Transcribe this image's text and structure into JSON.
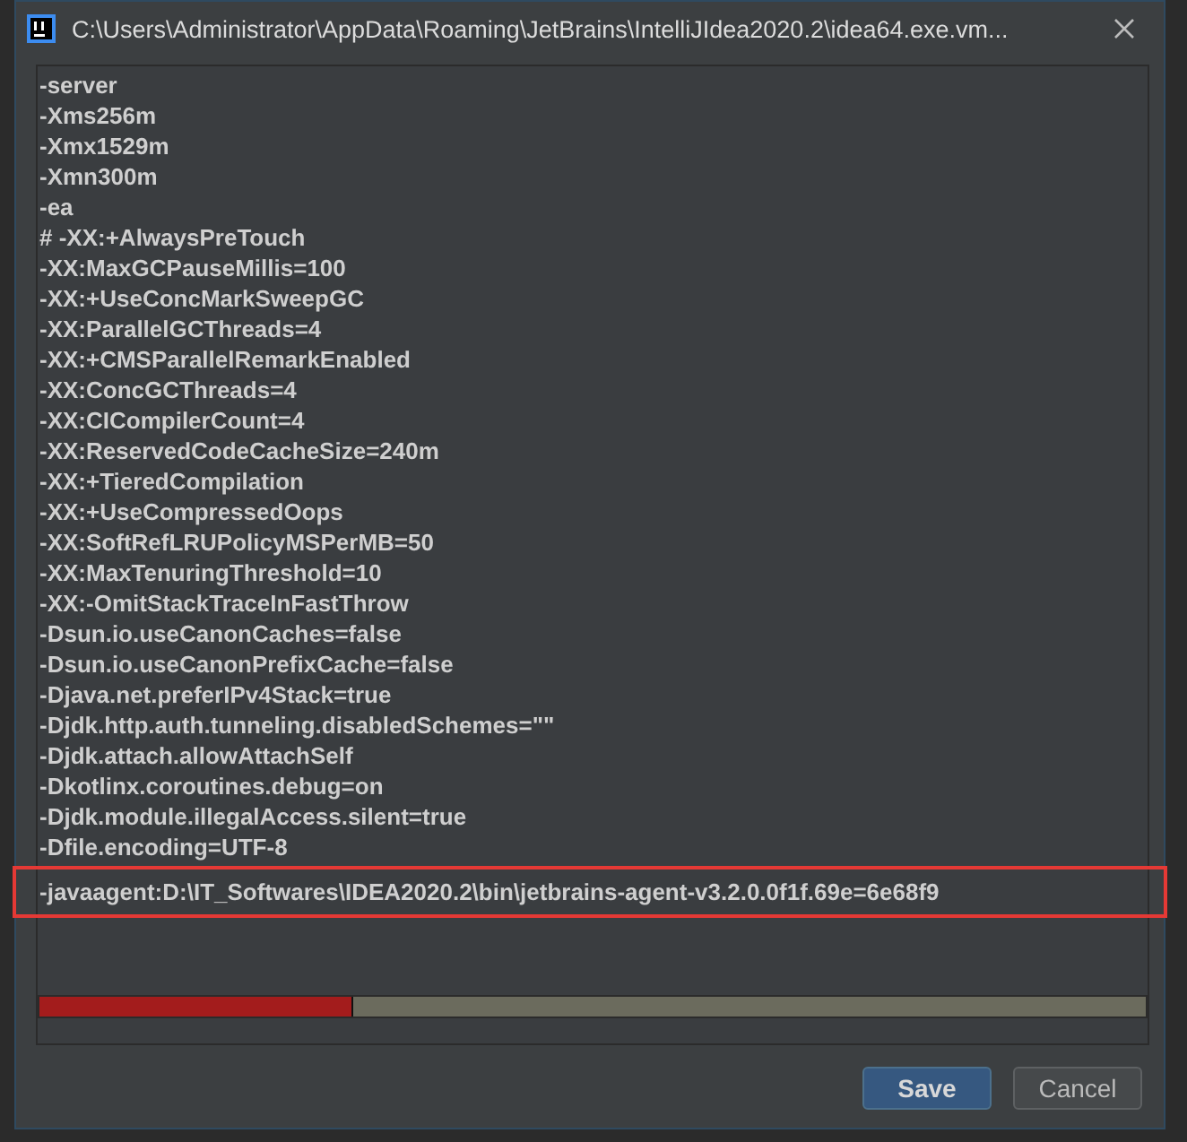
{
  "window": {
    "title": "C:\\Users\\Administrator\\AppData\\Roaming\\JetBrains\\IntelliJIdea2020.2\\idea64.exe.vm..."
  },
  "editor": {
    "lines": [
      {
        "text": "-server",
        "highlighted": false
      },
      {
        "text": "-Xms256m",
        "highlighted": false
      },
      {
        "text": "-Xmx1529m",
        "highlighted": false
      },
      {
        "text": "-Xmn300m",
        "highlighted": false
      },
      {
        "text": "-ea",
        "highlighted": false
      },
      {
        "text": "# -XX:+AlwaysPreTouch",
        "highlighted": false
      },
      {
        "text": "-XX:MaxGCPauseMillis=100",
        "highlighted": false
      },
      {
        "text": "-XX:+UseConcMarkSweepGC",
        "highlighted": false
      },
      {
        "text": "-XX:ParallelGCThreads=4",
        "highlighted": false
      },
      {
        "text": "-XX:+CMSParallelRemarkEnabled",
        "highlighted": false
      },
      {
        "text": "-XX:ConcGCThreads=4",
        "highlighted": false
      },
      {
        "text": "-XX:CICompilerCount=4",
        "highlighted": false
      },
      {
        "text": "-XX:ReservedCodeCacheSize=240m",
        "highlighted": false
      },
      {
        "text": "-XX:+TieredCompilation",
        "highlighted": false
      },
      {
        "text": "-XX:+UseCompressedOops",
        "highlighted": false
      },
      {
        "text": "-XX:SoftRefLRUPolicyMSPerMB=50",
        "highlighted": false
      },
      {
        "text": "-XX:MaxTenuringThreshold=10",
        "highlighted": false
      },
      {
        "text": "-XX:-OmitStackTraceInFastThrow",
        "highlighted": false
      },
      {
        "text": "-Dsun.io.useCanonCaches=false",
        "highlighted": false
      },
      {
        "text": "-Dsun.io.useCanonPrefixCache=false",
        "highlighted": false
      },
      {
        "text": "-Djava.net.preferIPv4Stack=true",
        "highlighted": false
      },
      {
        "text": "-Djdk.http.auth.tunneling.disabledSchemes=\"\"",
        "highlighted": false
      },
      {
        "text": "-Djdk.attach.allowAttachSelf",
        "highlighted": false
      },
      {
        "text": "-Dkotlinx.coroutines.debug=on",
        "highlighted": false
      },
      {
        "text": "-Djdk.module.illegalAccess.silent=true",
        "highlighted": false
      },
      {
        "text": "-Dfile.encoding=UTF-8",
        "highlighted": false
      },
      {
        "text": "-javaagent:D:\\IT_Softwares\\IDEA2020.2\\bin\\jetbrains-agent-v3.2.0.0f1f.69e=6e68f9",
        "highlighted": true
      }
    ]
  },
  "buttons": [
    {
      "label": "Save",
      "kind": "primary"
    },
    {
      "label": "Cancel",
      "kind": "secondary"
    }
  ]
}
